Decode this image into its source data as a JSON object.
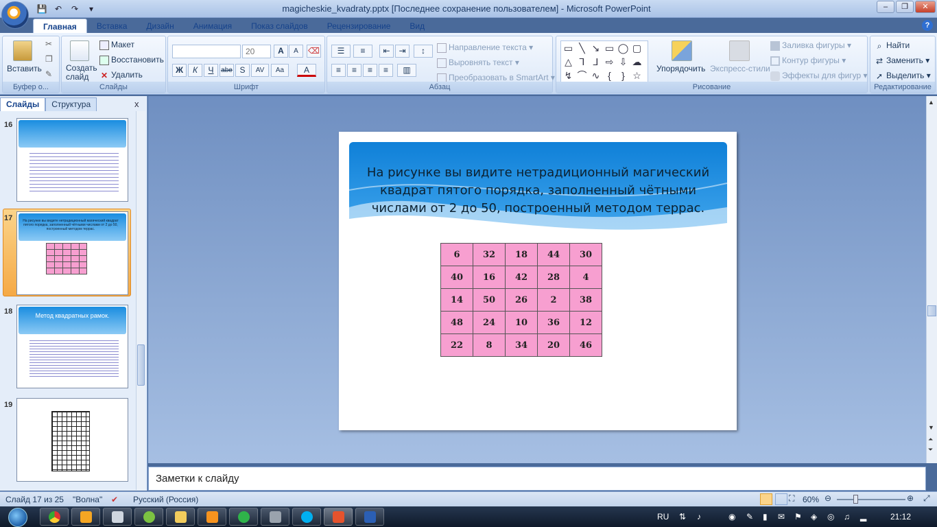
{
  "window": {
    "title": "magicheskie_kvadraty.pptx [Последнее сохранение пользователем] - Microsoft PowerPoint",
    "minimize": "–",
    "restore": "❐",
    "close": "✕"
  },
  "qat": [
    "💾",
    "↶",
    "↷",
    "▾"
  ],
  "tabs": [
    "Главная",
    "Вставка",
    "Дизайн",
    "Анимация",
    "Показ слайдов",
    "Рецензирование",
    "Вид"
  ],
  "ribbon": {
    "clipboard": {
      "paste": "Вставить",
      "label": "Буфер о..."
    },
    "slides": {
      "create": "Создать слайд",
      "layout": "Макет",
      "reset": "Восстановить",
      "delete": "Удалить",
      "label": "Слайды"
    },
    "font": {
      "size": "20",
      "label": "Шрифт",
      "bold": "Ж",
      "italic": "К",
      "underline": "Ч",
      "strike": "abe",
      "shadow": "S",
      "spacing": "AV",
      "case": "Aa",
      "color": "A",
      "grow": "A",
      "shrink": "A"
    },
    "paragraph": {
      "direction": "Направление текста",
      "align": "Выровнять текст",
      "smartart": "Преобразовать в SmartArt",
      "label": "Абзац"
    },
    "drawing": {
      "arrange": "Упорядочить",
      "styles": "Экспресс-стили",
      "fill": "Заливка фигуры",
      "outline": "Контур фигуры",
      "effects": "Эффекты для фигур",
      "label": "Рисование"
    },
    "editing": {
      "find": "Найти",
      "replace": "Заменить",
      "select": "Выделить",
      "label": "Редактирование"
    }
  },
  "panel": {
    "tab_slides": "Слайды",
    "tab_outline": "Структура",
    "close": "x"
  },
  "thumbs": {
    "n16": "16",
    "n17": "17",
    "n18": "18",
    "n19": "19",
    "t17_title": "На рисунке вы видите нетрадиционный магический квадрат пятого порядка, заполненный чётными числами от 2 до 50, построенный методом террас.",
    "t18_title": "Метод квадратных рамок."
  },
  "slide": {
    "title": "На рисунке вы видите нетрадиционный магический квадрат пятого порядка, заполненный чётными числами от 2 до 50, построенный методом террас.",
    "grid": [
      [
        "6",
        "32",
        "18",
        "44",
        "30"
      ],
      [
        "40",
        "16",
        "42",
        "28",
        "4"
      ],
      [
        "14",
        "50",
        "26",
        "2",
        "38"
      ],
      [
        "48",
        "24",
        "10",
        "36",
        "12"
      ],
      [
        "22",
        "8",
        "34",
        "20",
        "46"
      ]
    ]
  },
  "notes": "Заметки к слайду",
  "status": {
    "slide": "Слайд 17 из 25",
    "theme": "\"Волна\"",
    "lang": "Русский (Россия)",
    "zoom": "60%"
  },
  "tray": {
    "lang": "RU",
    "time": "21:12"
  },
  "colors": {
    "accent": "#f79fd0",
    "header": "#1a8de0"
  }
}
